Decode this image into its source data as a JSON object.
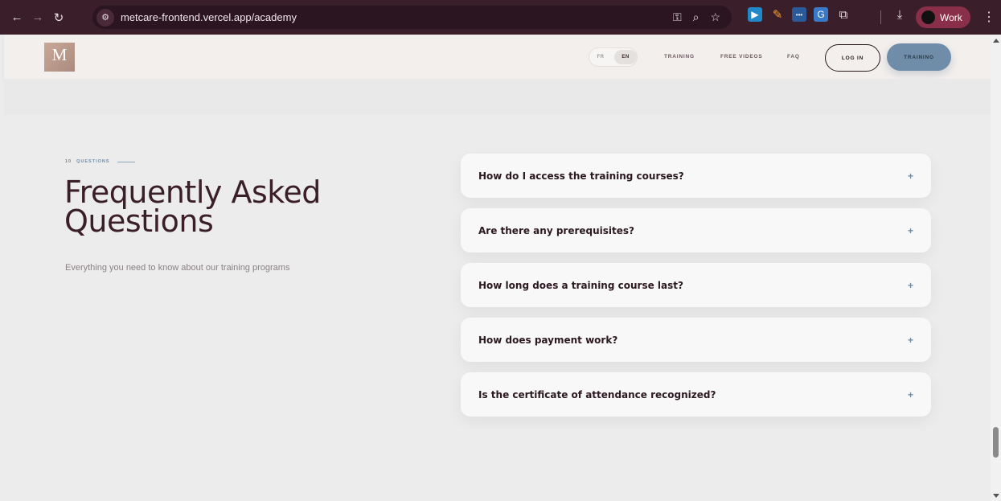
{
  "browser": {
    "url": "metcare-frontend.vercel.app/academy",
    "profile_label": "Work",
    "icons": [
      "back-icon",
      "forward-icon",
      "reload-icon",
      "site-info-icon",
      "password-key-icon",
      "zoom-icon",
      "bookmark-star-icon",
      "extension-icon",
      "pencil-extension-icon",
      "dots-extension-icon",
      "translate-extension-icon",
      "extensions-puzzle-icon",
      "download-icon",
      "menu-kebab-icon"
    ]
  },
  "header": {
    "logo_letter": "M",
    "lang_fr": "FR",
    "lang_en": "EN",
    "lang_active": "EN",
    "nav": [
      "TRAINING",
      "FREE VIDEOS",
      "FAQ"
    ],
    "login_label": "LOG IN",
    "training_button_label": "TRAINING"
  },
  "faq": {
    "eyebrow_number": "10",
    "eyebrow_label": "QUESTIONS",
    "title": "Frequently Asked Questions",
    "subtitle": "Everything you need to know about our training programs",
    "items": [
      {
        "question": "How do I access the training courses?",
        "toggle": "+"
      },
      {
        "question": "Are there any prerequisites?",
        "toggle": "+"
      },
      {
        "question": "How long does a training course last?",
        "toggle": "+"
      },
      {
        "question": "How does payment work?",
        "toggle": "+"
      },
      {
        "question": "Is the certificate of attendance recognized?",
        "toggle": "+"
      }
    ]
  },
  "colors": {
    "browser_frame": "#3a1e2a",
    "accent_blue": "#6f8ca8",
    "title_color": "#3a1e28",
    "page_bg": "#ececec"
  }
}
